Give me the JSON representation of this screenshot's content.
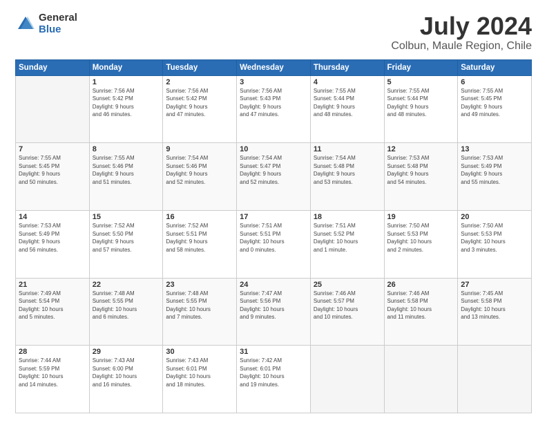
{
  "header": {
    "logo_general": "General",
    "logo_blue": "Blue",
    "month_title": "July 2024",
    "subtitle": "Colbun, Maule Region, Chile"
  },
  "days_of_week": [
    "Sunday",
    "Monday",
    "Tuesday",
    "Wednesday",
    "Thursday",
    "Friday",
    "Saturday"
  ],
  "weeks": [
    [
      {
        "day": "",
        "info": ""
      },
      {
        "day": "1",
        "info": "Sunrise: 7:56 AM\nSunset: 5:42 PM\nDaylight: 9 hours\nand 46 minutes."
      },
      {
        "day": "2",
        "info": "Sunrise: 7:56 AM\nSunset: 5:42 PM\nDaylight: 9 hours\nand 47 minutes."
      },
      {
        "day": "3",
        "info": "Sunrise: 7:56 AM\nSunset: 5:43 PM\nDaylight: 9 hours\nand 47 minutes."
      },
      {
        "day": "4",
        "info": "Sunrise: 7:55 AM\nSunset: 5:44 PM\nDaylight: 9 hours\nand 48 minutes."
      },
      {
        "day": "5",
        "info": "Sunrise: 7:55 AM\nSunset: 5:44 PM\nDaylight: 9 hours\nand 48 minutes."
      },
      {
        "day": "6",
        "info": "Sunrise: 7:55 AM\nSunset: 5:45 PM\nDaylight: 9 hours\nand 49 minutes."
      }
    ],
    [
      {
        "day": "7",
        "info": "Sunrise: 7:55 AM\nSunset: 5:45 PM\nDaylight: 9 hours\nand 50 minutes."
      },
      {
        "day": "8",
        "info": "Sunrise: 7:55 AM\nSunset: 5:46 PM\nDaylight: 9 hours\nand 51 minutes."
      },
      {
        "day": "9",
        "info": "Sunrise: 7:54 AM\nSunset: 5:46 PM\nDaylight: 9 hours\nand 52 minutes."
      },
      {
        "day": "10",
        "info": "Sunrise: 7:54 AM\nSunset: 5:47 PM\nDaylight: 9 hours\nand 52 minutes."
      },
      {
        "day": "11",
        "info": "Sunrise: 7:54 AM\nSunset: 5:48 PM\nDaylight: 9 hours\nand 53 minutes."
      },
      {
        "day": "12",
        "info": "Sunrise: 7:53 AM\nSunset: 5:48 PM\nDaylight: 9 hours\nand 54 minutes."
      },
      {
        "day": "13",
        "info": "Sunrise: 7:53 AM\nSunset: 5:49 PM\nDaylight: 9 hours\nand 55 minutes."
      }
    ],
    [
      {
        "day": "14",
        "info": "Sunrise: 7:53 AM\nSunset: 5:49 PM\nDaylight: 9 hours\nand 56 minutes."
      },
      {
        "day": "15",
        "info": "Sunrise: 7:52 AM\nSunset: 5:50 PM\nDaylight: 9 hours\nand 57 minutes."
      },
      {
        "day": "16",
        "info": "Sunrise: 7:52 AM\nSunset: 5:51 PM\nDaylight: 9 hours\nand 58 minutes."
      },
      {
        "day": "17",
        "info": "Sunrise: 7:51 AM\nSunset: 5:51 PM\nDaylight: 10 hours\nand 0 minutes."
      },
      {
        "day": "18",
        "info": "Sunrise: 7:51 AM\nSunset: 5:52 PM\nDaylight: 10 hours\nand 1 minute."
      },
      {
        "day": "19",
        "info": "Sunrise: 7:50 AM\nSunset: 5:53 PM\nDaylight: 10 hours\nand 2 minutes."
      },
      {
        "day": "20",
        "info": "Sunrise: 7:50 AM\nSunset: 5:53 PM\nDaylight: 10 hours\nand 3 minutes."
      }
    ],
    [
      {
        "day": "21",
        "info": "Sunrise: 7:49 AM\nSunset: 5:54 PM\nDaylight: 10 hours\nand 5 minutes."
      },
      {
        "day": "22",
        "info": "Sunrise: 7:48 AM\nSunset: 5:55 PM\nDaylight: 10 hours\nand 6 minutes."
      },
      {
        "day": "23",
        "info": "Sunrise: 7:48 AM\nSunset: 5:55 PM\nDaylight: 10 hours\nand 7 minutes."
      },
      {
        "day": "24",
        "info": "Sunrise: 7:47 AM\nSunset: 5:56 PM\nDaylight: 10 hours\nand 9 minutes."
      },
      {
        "day": "25",
        "info": "Sunrise: 7:46 AM\nSunset: 5:57 PM\nDaylight: 10 hours\nand 10 minutes."
      },
      {
        "day": "26",
        "info": "Sunrise: 7:46 AM\nSunset: 5:58 PM\nDaylight: 10 hours\nand 11 minutes."
      },
      {
        "day": "27",
        "info": "Sunrise: 7:45 AM\nSunset: 5:58 PM\nDaylight: 10 hours\nand 13 minutes."
      }
    ],
    [
      {
        "day": "28",
        "info": "Sunrise: 7:44 AM\nSunset: 5:59 PM\nDaylight: 10 hours\nand 14 minutes."
      },
      {
        "day": "29",
        "info": "Sunrise: 7:43 AM\nSunset: 6:00 PM\nDaylight: 10 hours\nand 16 minutes."
      },
      {
        "day": "30",
        "info": "Sunrise: 7:43 AM\nSunset: 6:01 PM\nDaylight: 10 hours\nand 18 minutes."
      },
      {
        "day": "31",
        "info": "Sunrise: 7:42 AM\nSunset: 6:01 PM\nDaylight: 10 hours\nand 19 minutes."
      },
      {
        "day": "",
        "info": ""
      },
      {
        "day": "",
        "info": ""
      },
      {
        "day": "",
        "info": ""
      }
    ]
  ]
}
